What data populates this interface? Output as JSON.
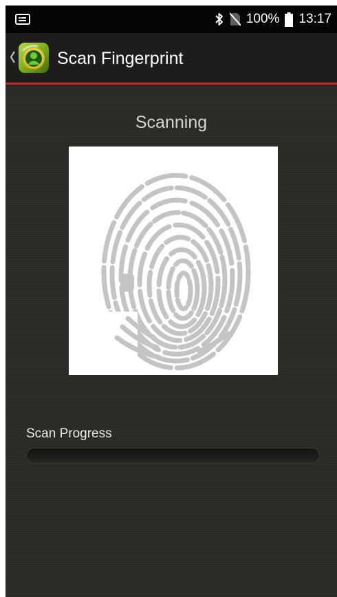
{
  "status_bar": {
    "battery": "100%",
    "time": "13:17",
    "icons": [
      "notification-icon",
      "bluetooth-icon",
      "no-sim-icon",
      "battery-icon"
    ]
  },
  "action_bar": {
    "title": "Scan Fingerprint",
    "back_icon": "chevron-left-icon",
    "app_icon": "app-logo-icon",
    "divider_color": "#c1271d"
  },
  "main": {
    "status": "Scanning",
    "image": "fingerprint-image",
    "progress_label": "Scan Progress",
    "progress_value": 0
  }
}
